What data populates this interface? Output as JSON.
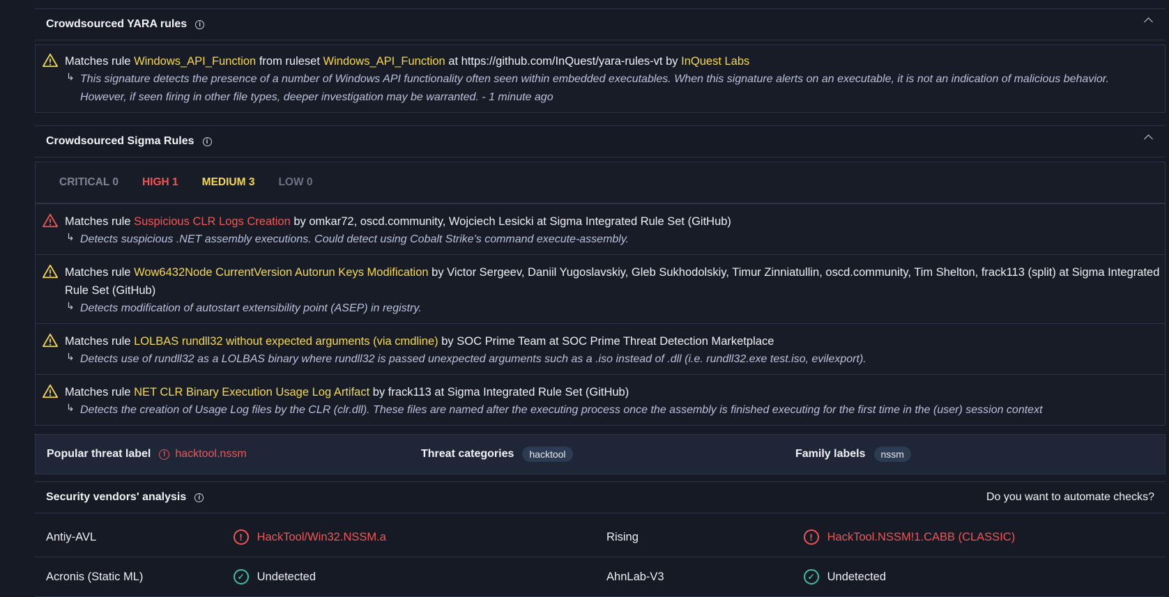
{
  "yara": {
    "title": "Crowdsourced YARA rules",
    "rules": [
      {
        "prefix": "Matches rule",
        "rule": "Windows_API_Function",
        "from": "from ruleset",
        "ruleset": "Windows_API_Function",
        "at": "at https://github.com/InQuest/yara-rules-vt by",
        "author": "InQuest Labs",
        "desc1": "This signature detects the presence of a number of Windows API functionality often seen within embedded executables. When this signature alerts on an executable, it is not an indication of malicious behavior.",
        "desc2": "However, if seen firing in other file types, deeper investigation may be warranted. - 1 minute ago"
      }
    ]
  },
  "sigma": {
    "title": "Crowdsourced Sigma Rules",
    "tabs": {
      "critical": "CRITICAL 0",
      "high": "HIGH 1",
      "medium": "MEDIUM 3",
      "low": "LOW 0"
    },
    "rules": [
      {
        "prefix": "Matches rule",
        "rule": "Suspicious CLR Logs Creation",
        "rest": "by omkar72, oscd.community, Wojciech Lesicki at Sigma Integrated Rule Set (GitHub)",
        "desc": "Detects suspicious .NET assembly executions. Could detect using Cobalt Strike's command execute-assembly."
      },
      {
        "prefix": "Matches rule",
        "rule": "Wow6432Node CurrentVersion Autorun Keys Modification",
        "rest": "by Victor Sergeev, Daniil Yugoslavskiy, Gleb Sukhodolskiy, Timur Zinniatullin, oscd.community, Tim Shelton, frack113 (split) at Sigma Integrated",
        "rest2": "Rule Set (GitHub)",
        "desc": "Detects modification of autostart extensibility point (ASEP) in registry."
      },
      {
        "prefix": "Matches rule",
        "rule": "LOLBAS rundll32 without expected arguments (via cmdline)",
        "rest": "by SOC Prime Team at SOC Prime Threat Detection Marketplace",
        "desc": "Detects use of rundll32 as a LOLBAS binary where rundll32 is passed unexpected arguments such as a .iso instead of .dll (i.e. rundll32.exe test.iso, evilexport)."
      },
      {
        "prefix": "Matches rule",
        "rule": "NET CLR Binary Execution Usage Log Artifact",
        "rest": "by frack113 at Sigma Integrated Rule Set (GitHub)",
        "desc": "Detects the creation of Usage Log files by the CLR (clr.dll). These files are named after the executing process once the assembly is finished executing for the first time in the (user) session context"
      }
    ]
  },
  "threat": {
    "popular_label": "Popular threat label",
    "popular_value": "hacktool.nssm",
    "categories_label": "Threat categories",
    "categories_value": "hacktool",
    "family_label": "Family labels",
    "family_value": "nssm"
  },
  "vendors": {
    "title": "Security vendors' analysis",
    "automate": "Do you want to automate checks?",
    "rows": [
      {
        "name1": "Antiy-AVL",
        "result1": "HackTool/Win32.NSSM.a",
        "name2": "Rising",
        "result2": "HackTool.NSSM!1.CABB (CLASSIC)"
      },
      {
        "name1": "Acronis (Static ML)",
        "result1": "Undetected",
        "name2": "AhnLab-V3",
        "result2": "Undetected"
      }
    ]
  },
  "colors": {
    "high": "#f05656",
    "medium": "#f5d94a",
    "ok": "#3fbf9f"
  }
}
